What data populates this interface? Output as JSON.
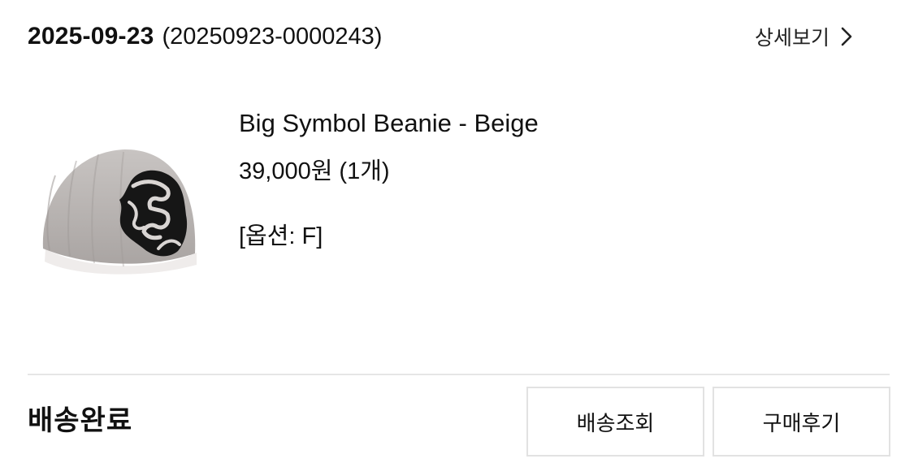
{
  "order": {
    "date": "2025-09-23",
    "number": "(20250923-0000243)",
    "detail_label": "상세보기",
    "detail_icon": "chevron-right-icon"
  },
  "product": {
    "name": "Big Symbol Beanie - Beige",
    "price": "39,000원 (1개)",
    "option": "[옵션: F]",
    "image_icon": "beanie-image",
    "colors": {
      "beanie": "#bdb8b6",
      "symbol": "#111111",
      "cuff": "#f1efee"
    }
  },
  "status": {
    "label": "배송완료"
  },
  "actions": {
    "tracking_label": "배송조회",
    "review_label": "구매후기"
  }
}
